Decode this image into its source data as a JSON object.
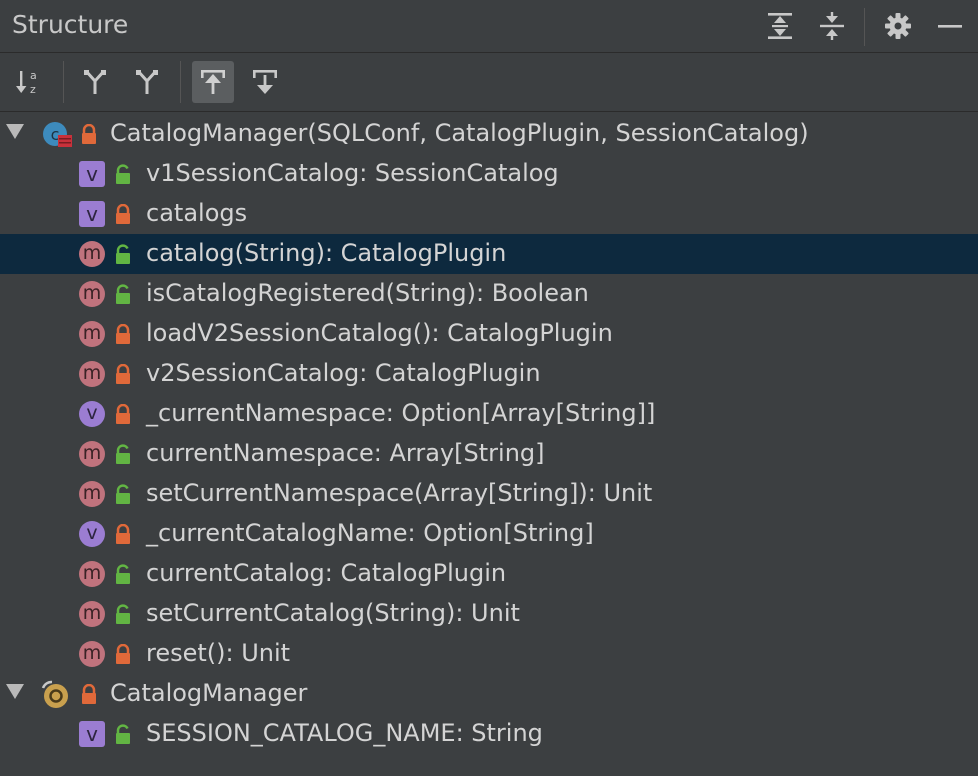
{
  "header": {
    "title": "Structure",
    "buttons": [
      {
        "name": "expand-all-icon"
      },
      {
        "name": "collapse-all-icon"
      },
      {
        "name": "gear-icon"
      },
      {
        "name": "minimize-icon"
      }
    ]
  },
  "toolbar": {
    "buttons": [
      {
        "name": "sort-alphabetically-icon",
        "active": false
      },
      {
        "name": "show-inherited-icon",
        "active": false
      },
      {
        "name": "show-implicits-icon",
        "active": false
      },
      {
        "name": "autoscroll-to-source-icon",
        "active": true
      },
      {
        "name": "autoscroll-from-source-icon",
        "active": false
      }
    ]
  },
  "colors": {
    "background": "#3c3f41",
    "selection": "#0d293e",
    "variable_icon": "#9b7dd2",
    "method_icon": "#c0737d",
    "public_lock": "#62b543",
    "private_lock": "#e0693a",
    "class_icon": "#3d8bbd",
    "object_icon": "#c9a04e"
  },
  "tree": {
    "nodes": [
      {
        "kind": "class",
        "access": "private",
        "expanded": true,
        "label": "CatalogManager(SQLConf, CatalogPlugin, SessionCatalog)"
      },
      {
        "kind": "val",
        "access": "public",
        "label": "v1SessionCatalog: SessionCatalog"
      },
      {
        "kind": "val",
        "access": "private",
        "label": "catalogs"
      },
      {
        "kind": "method",
        "access": "public",
        "label": "catalog(String): CatalogPlugin",
        "selected": true
      },
      {
        "kind": "method",
        "access": "public",
        "label": "isCatalogRegistered(String): Boolean"
      },
      {
        "kind": "method",
        "access": "private",
        "label": "loadV2SessionCatalog(): CatalogPlugin"
      },
      {
        "kind": "method",
        "access": "private",
        "label": "v2SessionCatalog: CatalogPlugin"
      },
      {
        "kind": "var",
        "access": "private",
        "label": "_currentNamespace: Option[Array[String]]"
      },
      {
        "kind": "method",
        "access": "public",
        "label": "currentNamespace: Array[String]"
      },
      {
        "kind": "method",
        "access": "public",
        "label": "setCurrentNamespace(Array[String]): Unit"
      },
      {
        "kind": "var",
        "access": "private",
        "label": "_currentCatalogName: Option[String]"
      },
      {
        "kind": "method",
        "access": "public",
        "label": "currentCatalog: CatalogPlugin"
      },
      {
        "kind": "method",
        "access": "public",
        "label": "setCurrentCatalog(String): Unit"
      },
      {
        "kind": "method",
        "access": "private",
        "label": "reset(): Unit"
      },
      {
        "kind": "object",
        "access": "private",
        "expanded": true,
        "label": "CatalogManager"
      },
      {
        "kind": "val",
        "access": "public",
        "label": "SESSION_CATALOG_NAME: String"
      }
    ]
  }
}
